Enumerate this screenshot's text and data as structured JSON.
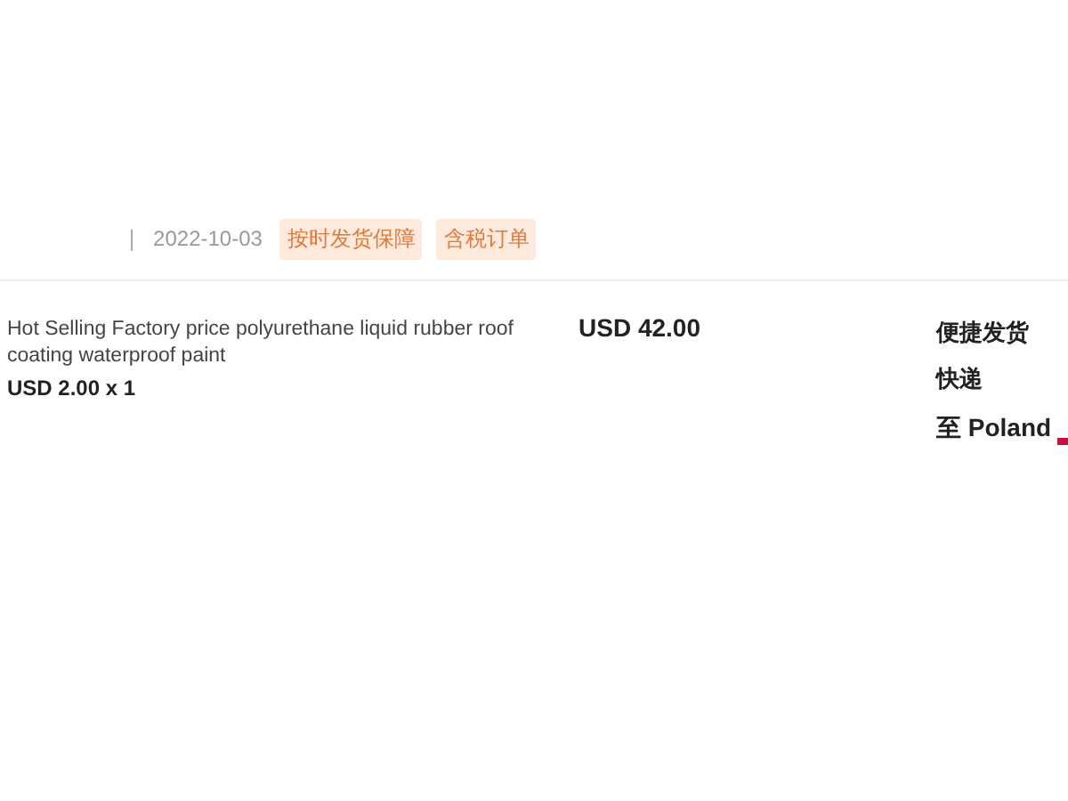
{
  "order_header": {
    "separator": "|",
    "date": "2022-10-03",
    "tags": [
      "按时发货保障",
      "含税订单"
    ]
  },
  "item": {
    "title": "Hot Selling Factory price polyurethane liquid rubber roof coating waterproof paint",
    "unit_price": "USD 2.00 x 1",
    "total": "USD 42.00"
  },
  "shipping": {
    "method": "便捷发货",
    "carrier": "快递",
    "destination": "至 Poland"
  }
}
